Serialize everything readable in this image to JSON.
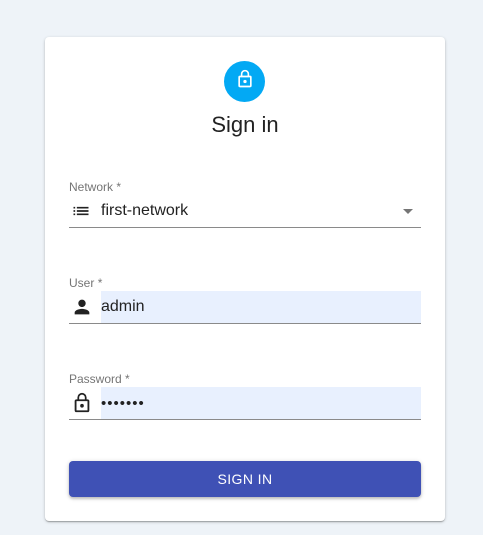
{
  "header": {
    "avatar_icon": "lock-outline-icon",
    "title": "Sign in"
  },
  "form": {
    "network": {
      "label": "Network",
      "required_mark": "*",
      "icon": "list-icon",
      "value": "first-network"
    },
    "user": {
      "label": "User",
      "required_mark": "*",
      "icon": "person-icon",
      "value": "admin"
    },
    "password": {
      "label": "Password",
      "required_mark": "*",
      "icon": "lock-icon",
      "value": "•••••••"
    },
    "submit_label": "SIGN IN"
  },
  "colors": {
    "background": "#eef3f8",
    "avatar": "#03a9f4",
    "button": "#3f51b5",
    "autofill": "#e8f0fe"
  }
}
